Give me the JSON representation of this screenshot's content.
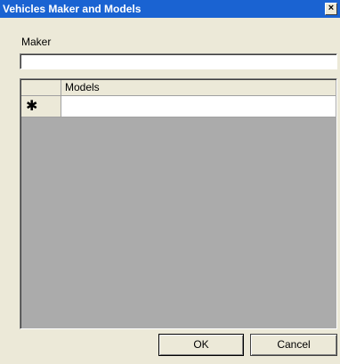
{
  "window": {
    "title": "Vehicles Maker and Models",
    "close_symbol": "×"
  },
  "form": {
    "maker_label": "Maker",
    "maker_value": ""
  },
  "grid": {
    "columns": [
      "Models"
    ],
    "new_row_marker": "✱",
    "rows": []
  },
  "buttons": {
    "ok_label": "OK",
    "cancel_label": "Cancel"
  },
  "colors": {
    "titlebar": "#1a63d2",
    "face": "#ece9d8",
    "grid_background": "#ababab"
  }
}
